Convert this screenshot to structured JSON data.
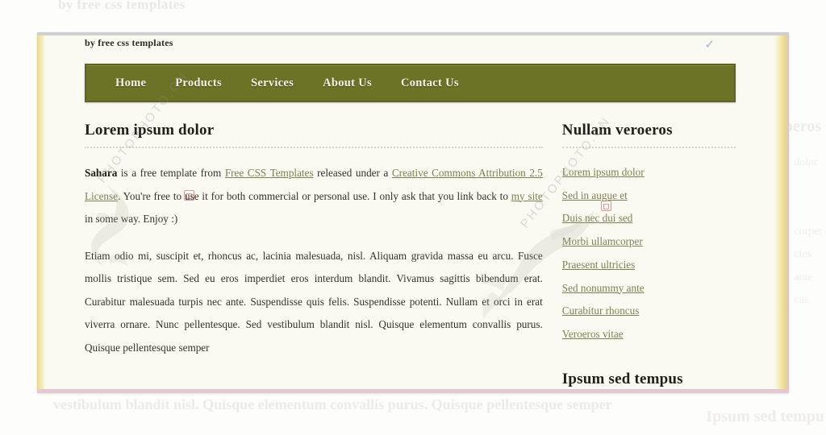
{
  "site": {
    "tagline": "by free css templates",
    "header_mark": "✓"
  },
  "nav": {
    "items": [
      {
        "label": "Home"
      },
      {
        "label": "Products"
      },
      {
        "label": "Services"
      },
      {
        "label": "About Us"
      },
      {
        "label": "Contact Us"
      }
    ]
  },
  "main": {
    "heading": "Lorem ipsum dolor",
    "intro": {
      "strong": "Sahara",
      "text_1": " is a free template from ",
      "link_1": "Free CSS Templates",
      "text_2": " released under a ",
      "link_2": "Creative Commons Attribution 2.5 License",
      "text_3": ". You're free to use it for both commercial or personal use. I only ask that you link back to ",
      "link_3": "my site",
      "text_4": " in some way. Enjoy :)"
    },
    "paragraph_2": "Etiam odio mi, suscipit et, rhoncus ac, lacinia malesuada, nisl. Aliquam gravida massa eu arcu. Fusce mollis tristique sem. Sed eu eros imperdiet eros interdum blandit. Vivamus sagittis bibendum erat. Curabitur malesuada turpis nec ante. Suspendisse quis felis. Suspendisse potenti. Nullam et orci in erat viverra ornare. Nunc pellentesque. Sed vestibulum blandit nisl. Quisque elementum convallis purus. Quisque pellentesque semper"
  },
  "sidebar": {
    "heading_1": "Nullam veroeros",
    "links": [
      {
        "label": "Lorem ipsum dolor"
      },
      {
        "label": "Sed in augue et"
      },
      {
        "label": "Duis nec dui sed"
      },
      {
        "label": "Morbi ullamcorper"
      },
      {
        "label": "Praesent ultricies"
      },
      {
        "label": "Sed nonummy ante"
      },
      {
        "label": "Curabitur rhoncus"
      },
      {
        "label": "Veroeros vitae"
      }
    ],
    "heading_2": "Ipsum sed tempus"
  },
  "background": {
    "tagline": "by free css templates",
    "side_heading": "eroeros",
    "side_links": [
      "dolor",
      "",
      "",
      "corper",
      "cies",
      "ante",
      "cus",
      ""
    ],
    "bottom_paragraph": "vestibulum blandit nisl. Quisque elementum convallis purus. Quisque pellentesque semper",
    "side_heading_2": "Ipsum sed tempu"
  },
  "watermark": {
    "text": "PHOTOPHOTO.CN",
    "seal": "seal-stamp"
  },
  "colors": {
    "nav_bg": "#6d7326",
    "nav_border": "#5d6320",
    "page_bg": "#fbfaf2",
    "link": "#7c7f4e",
    "frame_bottom": "#e5c8cf",
    "stripe_yellow": "#e9d98a"
  }
}
